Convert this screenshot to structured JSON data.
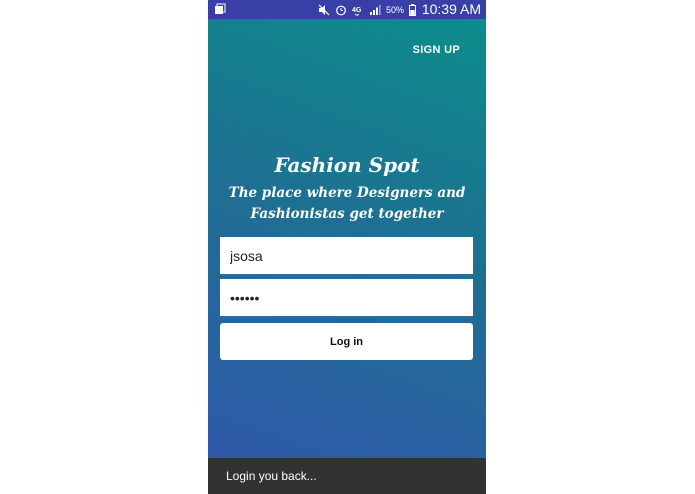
{
  "status_bar": {
    "battery_percent": "50%",
    "time": "10:39 AM",
    "network": "4G",
    "icons": [
      "notification-icon",
      "mute-icon",
      "alarm-icon",
      "network-4g-icon",
      "signal-icon",
      "battery-icon"
    ]
  },
  "header": {
    "sign_up_label": "SIGN UP"
  },
  "branding": {
    "title": "Fashion Spot",
    "tagline": "The place where Designers and Fashionistas get together"
  },
  "login_form": {
    "username_value": "jsosa",
    "password_value": "••••••",
    "login_label": "Log in"
  },
  "snackbar": {
    "message": "Login you back..."
  },
  "colors": {
    "status_bar": "#3a3fa8",
    "gradient_top": "#0a8f8a",
    "gradient_bottom": "#3156ad",
    "snackbar": "#323232"
  }
}
